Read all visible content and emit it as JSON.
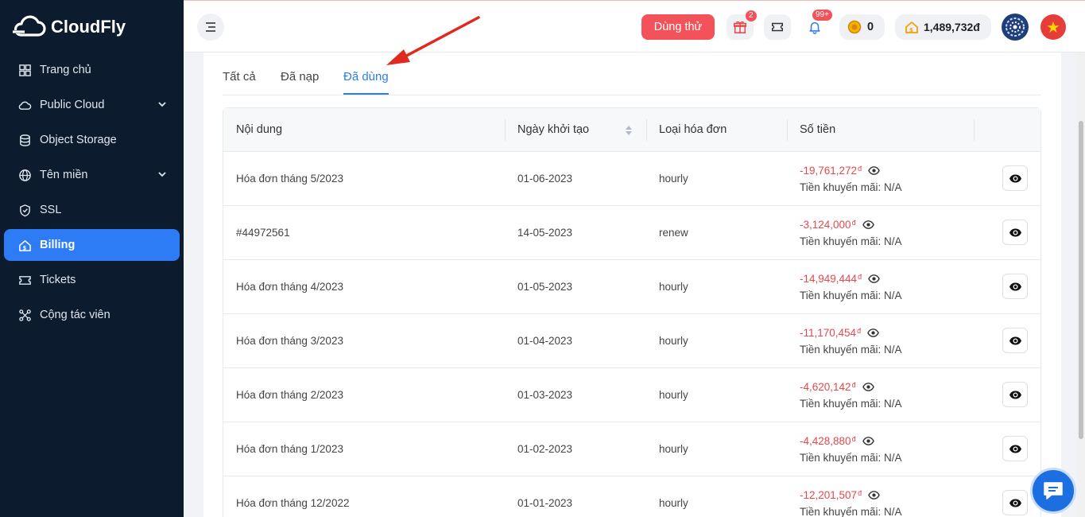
{
  "brand": {
    "name": "CloudFly"
  },
  "sidebar": {
    "items": [
      {
        "label": "Trang chủ",
        "icon": "grid-icon",
        "expandable": false,
        "active": false
      },
      {
        "label": "Public Cloud",
        "icon": "cloud-icon",
        "expandable": true,
        "active": false
      },
      {
        "label": "Object Storage",
        "icon": "database-icon",
        "expandable": false,
        "active": false
      },
      {
        "label": "Tên miền",
        "icon": "globe-icon",
        "expandable": true,
        "active": false
      },
      {
        "label": "SSL",
        "icon": "shield-icon",
        "expandable": false,
        "active": false
      },
      {
        "label": "Billing",
        "icon": "billing-home-icon",
        "expandable": false,
        "active": true
      },
      {
        "label": "Tickets",
        "icon": "ticket-icon",
        "expandable": false,
        "active": false
      },
      {
        "label": "Cộng tác viên",
        "icon": "network-icon",
        "expandable": false,
        "active": false
      }
    ]
  },
  "header": {
    "try_label": "Dùng thử",
    "gift_badge": "2",
    "notif_badge": "99+",
    "coins": "0",
    "balance": "1,489,732đ"
  },
  "tabs": [
    {
      "label": "Tất cả",
      "active": false
    },
    {
      "label": "Đã nạp",
      "active": false
    },
    {
      "label": "Đã dùng",
      "active": true
    }
  ],
  "table": {
    "columns": [
      "Nội dung",
      "Ngày khởi tạo",
      "Loại hóa đơn",
      "Số tiền"
    ],
    "currency_mark": "đ",
    "promo_label": "Tiền khuyến mãi: N/A",
    "rows": [
      {
        "content": "Hóa đơn tháng 5/2023",
        "date": "01-06-2023",
        "type": "hourly",
        "amount": "-19,761,272"
      },
      {
        "content": "#44972561",
        "date": "14-05-2023",
        "type": "renew",
        "amount": "-3,124,000"
      },
      {
        "content": "Hóa đơn tháng 4/2023",
        "date": "01-05-2023",
        "type": "hourly",
        "amount": "-14,949,444"
      },
      {
        "content": "Hóa đơn tháng 3/2023",
        "date": "01-04-2023",
        "type": "hourly",
        "amount": "-11,170,454"
      },
      {
        "content": "Hóa đơn tháng 2/2023",
        "date": "01-03-2023",
        "type": "hourly",
        "amount": "-4,620,142"
      },
      {
        "content": "Hóa đơn tháng 1/2023",
        "date": "01-02-2023",
        "type": "hourly",
        "amount": "-4,428,880"
      },
      {
        "content": "Hóa đơn tháng 12/2022",
        "date": "01-01-2023",
        "type": "hourly",
        "amount": "-12,201,507"
      }
    ]
  },
  "colors": {
    "sidebar_bg": "#0d1b2e",
    "accent": "#2d7cf6",
    "danger": "#f4525a",
    "amount": "#e5484d"
  }
}
